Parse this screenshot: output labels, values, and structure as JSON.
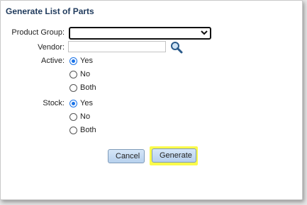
{
  "dialog": {
    "title": "Generate List of Parts"
  },
  "fields": {
    "product_group_label": "Product Group:",
    "product_group_value": "",
    "vendor_label": "Vendor:",
    "vendor_value": "",
    "active_label": "Active:",
    "stock_label": "Stock:"
  },
  "active_options": [
    {
      "label": "Yes",
      "checked": true
    },
    {
      "label": "No",
      "checked": false
    },
    {
      "label": "Both",
      "checked": false
    }
  ],
  "stock_options": [
    {
      "label": "Yes",
      "checked": true
    },
    {
      "label": "No",
      "checked": false
    },
    {
      "label": "Both",
      "checked": false
    }
  ],
  "buttons": {
    "cancel": "Cancel",
    "generate": "Generate"
  },
  "icons": {
    "lookup": "magnifier-icon",
    "dropdown": "chevron-down-icon"
  },
  "colors": {
    "accent": "#1a73e8",
    "title": "#1f3a5c",
    "highlight": "#fbfb4a"
  }
}
